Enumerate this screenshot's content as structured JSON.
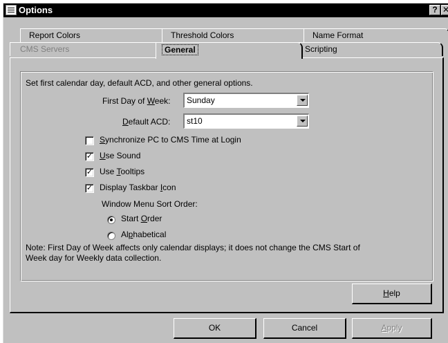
{
  "window": {
    "title": "Options",
    "help_glyph": "?",
    "close_glyph": "✕",
    "icon": "options-window-icon"
  },
  "tabs": {
    "row1": [
      "Report Colors",
      "Threshold Colors",
      "Name Format"
    ],
    "row2": [
      "CMS Servers",
      "General",
      "Scripting"
    ],
    "active": "General",
    "disabled": [
      "CMS Servers"
    ]
  },
  "general": {
    "description": "Set first calendar day, default ACD, and other general options.",
    "first_day": {
      "label_pre": "First Day of ",
      "label_key": "W",
      "label_post": "eek:",
      "value": "Sunday"
    },
    "default_acd": {
      "label_pre": "",
      "label_key": "D",
      "label_post": "efault ACD:",
      "value": "st10"
    },
    "checkboxes": [
      {
        "key": "S",
        "rest": "ynchronize PC to CMS Time at Login",
        "checked": false,
        "mark": ""
      },
      {
        "key": "U",
        "rest": "se Sound",
        "checked": true,
        "mark": "✓"
      },
      {
        "pre": "Use ",
        "key": "T",
        "rest": "ooltips",
        "checked": true,
        "mark": "✓"
      },
      {
        "pre": "Display Taskbar ",
        "key": "I",
        "rest": "con",
        "checked": true,
        "mark": "✓"
      }
    ],
    "sort_order": {
      "label": "Window Menu Sort Order:",
      "options": [
        {
          "pre": "Start ",
          "key": "O",
          "rest": "rder",
          "selected": true
        },
        {
          "pre": "Al",
          "key": "p",
          "rest": "habetical",
          "selected": false
        }
      ]
    },
    "note_line1": "Note: First Day of Week affects only calendar displays; it does not change the CMS Start of",
    "note_line2": "Week day for Weekly data collection."
  },
  "buttons": {
    "help": {
      "key": "H",
      "rest": "elp"
    },
    "ok": "OK",
    "cancel": "Cancel",
    "apply": {
      "key": "A",
      "rest": "pply",
      "disabled": true
    }
  }
}
